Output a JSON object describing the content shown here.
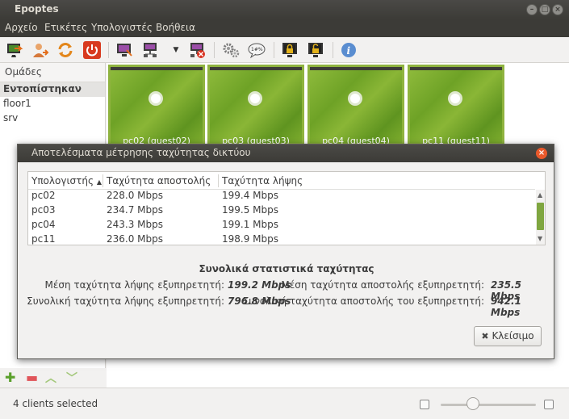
{
  "window": {
    "title": "Epoptes",
    "controls": [
      "minimize-icon",
      "maximize-icon",
      "close-icon"
    ]
  },
  "menubar": {
    "items": [
      "Αρχείο",
      "Ετικέτες",
      "Υπολογιστές",
      "Βοήθεια"
    ]
  },
  "toolbar": {
    "icons": [
      "login-icon",
      "user-icon",
      "refresh-icon",
      "power-icon",
      "broadcast-screen-icon",
      "network-icon",
      "dropdown-arrow-icon",
      "stop-broadcast-icon",
      "settings-icon",
      "message-icon",
      "lock-screen-icon",
      "unlock-screen-icon",
      "info-icon"
    ]
  },
  "sidebar": {
    "header": "Ομάδες",
    "items": [
      {
        "label": "Εντοπίστηκαν",
        "selected": true
      },
      {
        "label": "floor1",
        "selected": false
      },
      {
        "label": "srv",
        "selected": false
      }
    ],
    "footer_icons": [
      "add-icon",
      "remove-icon",
      "move-up-icon",
      "move-down-icon"
    ]
  },
  "clients": [
    {
      "label": "pc02 (guest02)"
    },
    {
      "label": "pc03 (guest03)"
    },
    {
      "label": "pc04 (guest04)"
    },
    {
      "label": "pc11 (guest11)"
    }
  ],
  "statusbar": {
    "text": "4 clients selected",
    "zoom_level": 0.34
  },
  "dialog": {
    "title": "Αποτελέσματα μέτρησης ταχύτητας δικτύου",
    "columns": [
      "Υπολογιστής",
      "Ταχύτητα αποστολής",
      "Ταχύτητα λήψης"
    ],
    "sort_indicator": "▲",
    "rows": [
      {
        "host": "pc02",
        "send": "228.0 Mbps",
        "recv": "199.4 Mbps"
      },
      {
        "host": "pc03",
        "send": "234.7 Mbps",
        "recv": "199.5 Mbps"
      },
      {
        "host": "pc04",
        "send": "243.3 Mbps",
        "recv": "199.1 Mbps"
      },
      {
        "host": "pc11",
        "send": "236.0 Mbps",
        "recv": "198.9 Mbps"
      }
    ],
    "stats": {
      "title": "Συνολικά στατιστικά ταχύτητας",
      "avg_recv_label": "Μέση ταχύτητα λήψης εξυπηρετητή:",
      "avg_recv_value": "199.2 Mbps",
      "avg_send_label": "Μέση ταχύτητα αποστολής εξυπηρετητή:",
      "avg_send_value": "235.5 Mbps",
      "total_recv_label": "Συνολική ταχύτητα λήψης εξυπηρετητή:",
      "total_recv_value": "796.8 Mbps",
      "total_send_label": "Συνολική ταχύτητα αποστολής του εξυπηρετητή:",
      "total_send_value": "942.1 Mbps"
    },
    "close_button": "Κλείσιμο",
    "close_icon_glyph": "✖"
  },
  "colors": {
    "titlebar": "#3c3b37",
    "accent_green": "#7cab2a",
    "close_orange": "#e9592b"
  }
}
